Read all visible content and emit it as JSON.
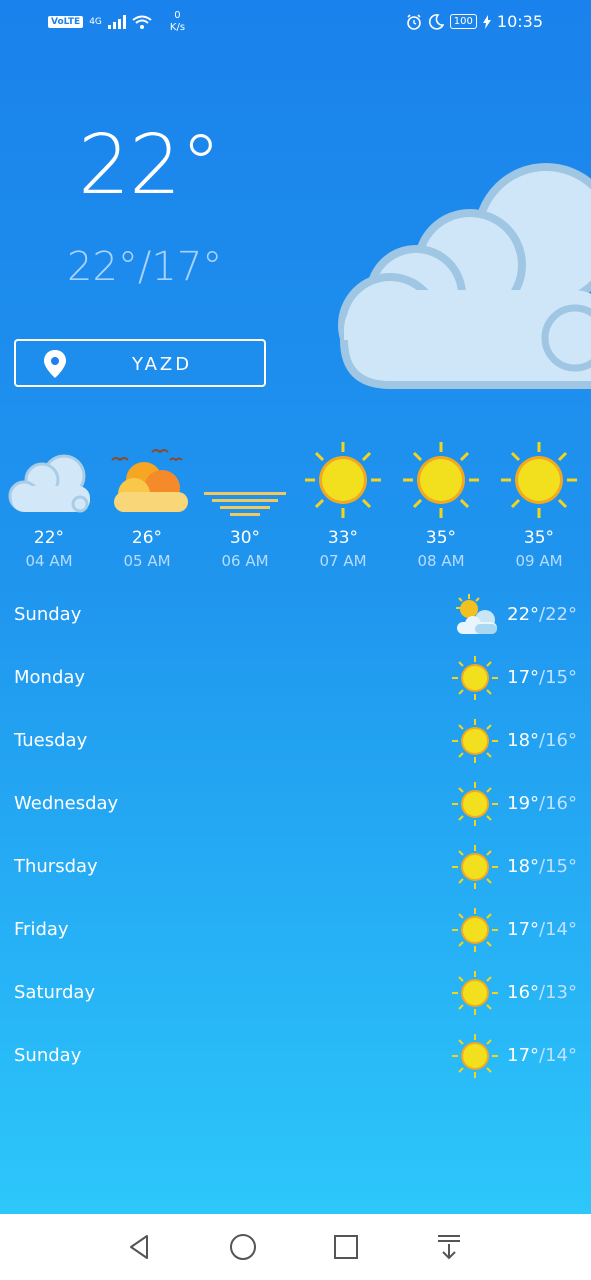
{
  "status_bar": {
    "volte": "VoLTE",
    "network": "4G",
    "net_speed_value": "0",
    "net_speed_unit": "K/s",
    "battery": "100",
    "time": "10:35"
  },
  "current": {
    "temperature": "22°",
    "range": "22°/17°"
  },
  "location": {
    "label": "YAZD"
  },
  "hourly": [
    {
      "temp": "22°",
      "time": "04 AM",
      "icon": "cloud-icon"
    },
    {
      "temp": "26°",
      "time": "05 AM",
      "icon": "sunrise-clouds-icon"
    },
    {
      "temp": "30°",
      "time": "06 AM",
      "icon": "moon-icon"
    },
    {
      "temp": "33°",
      "time": "07 AM",
      "icon": "sun-icon"
    },
    {
      "temp": "35°",
      "time": "08 AM",
      "icon": "sun-icon"
    },
    {
      "temp": "35°",
      "time": "09 AM",
      "icon": "sun-icon"
    }
  ],
  "daily": [
    {
      "day": "Sunday",
      "high": "22°",
      "low": "/22°",
      "icon": "partly-cloudy-icon"
    },
    {
      "day": "Monday",
      "high": "17°",
      "low": "/15°",
      "icon": "sun-icon"
    },
    {
      "day": "Tuesday",
      "high": "18°",
      "low": "/16°",
      "icon": "sun-icon"
    },
    {
      "day": "Wednesday",
      "high": "19°",
      "low": "/16°",
      "icon": "sun-icon"
    },
    {
      "day": "Thursday",
      "high": "18°",
      "low": "/15°",
      "icon": "sun-icon"
    },
    {
      "day": "Friday",
      "high": "17°",
      "low": "/14°",
      "icon": "sun-icon"
    },
    {
      "day": "Saturday",
      "high": "16°",
      "low": "/13°",
      "icon": "sun-icon"
    },
    {
      "day": "Sunday",
      "high": "17°",
      "low": "/14°",
      "icon": "sun-icon"
    }
  ],
  "nav_bar": {
    "icons": [
      "back-icon",
      "home-icon",
      "recents-icon",
      "notification-pull-icon"
    ]
  },
  "colors": {
    "background_top": "#1a82ec",
    "background_bottom": "#2fcdfb",
    "sun": "#f2d41f",
    "cloud": "#cfe6f8"
  }
}
